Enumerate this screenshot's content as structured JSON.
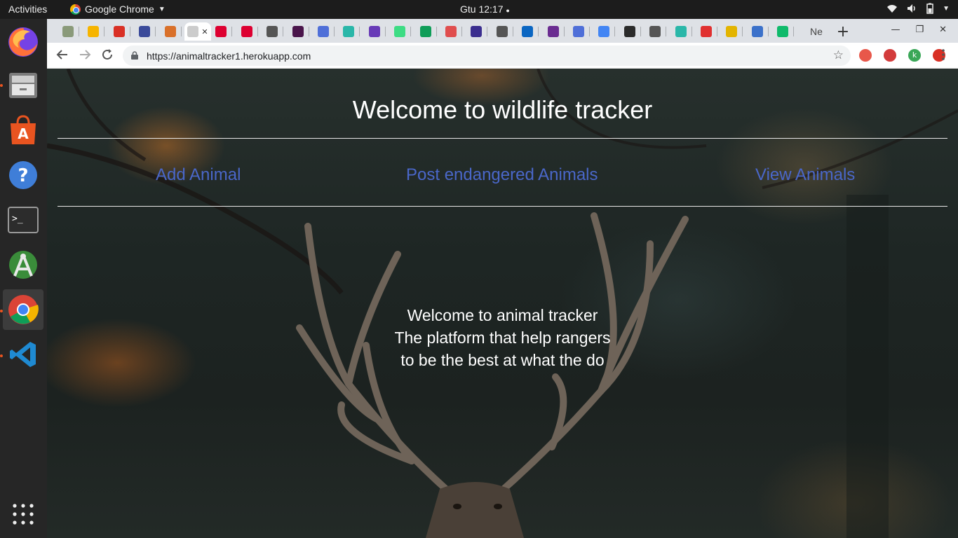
{
  "topbar": {
    "activities": "Activities",
    "app_name": "Google Chrome",
    "clock": "Gtu 12:17"
  },
  "dock": {
    "items": [
      {
        "name": "firefox-icon",
        "running": false
      },
      {
        "name": "files-icon",
        "running": true
      },
      {
        "name": "software-center-icon",
        "running": false
      },
      {
        "name": "help-icon",
        "running": false
      },
      {
        "name": "terminal-icon",
        "running": false
      },
      {
        "name": "android-studio-icon",
        "running": false
      },
      {
        "name": "chrome-icon",
        "running": true,
        "active": true
      },
      {
        "name": "vscode-icon",
        "running": true
      },
      {
        "name": "show-apps-icon",
        "running": false
      }
    ]
  },
  "tabs": [
    {
      "icon": "tree-icon",
      "color": "#8a9a7a"
    },
    {
      "icon": "drive-icon",
      "color": "#f6b400"
    },
    {
      "icon": "gmail-icon",
      "color": "#d93025"
    },
    {
      "icon": "github-icon",
      "color": "#3a4a9a"
    },
    {
      "icon": "book-icon",
      "color": "#d9702a"
    },
    {
      "icon": "animal-tracker-icon",
      "color": "#cccccc",
      "active": true
    },
    {
      "icon": "angular-icon",
      "color": "#dd0031"
    },
    {
      "icon": "angular-icon",
      "color": "#dd0031"
    },
    {
      "icon": "globe-icon",
      "color": "#555555"
    },
    {
      "icon": "slack-icon",
      "color": "#4a154b"
    },
    {
      "icon": "docs-icon",
      "color": "#4f6fd8"
    },
    {
      "icon": "dribbble-icon",
      "color": "#2ab7a9"
    },
    {
      "icon": "forms-icon",
      "color": "#673ab7"
    },
    {
      "icon": "android-icon",
      "color": "#3ddc84"
    },
    {
      "icon": "trello-icon",
      "color": "#0f9d58"
    },
    {
      "icon": "openai-icon",
      "color": "#e04e4e"
    },
    {
      "icon": "eclipse-icon",
      "color": "#3b2e8f"
    },
    {
      "icon": "audio-icon",
      "color": "#555555"
    },
    {
      "icon": "linkedin-icon",
      "color": "#0a66c2"
    },
    {
      "icon": "mail-icon",
      "color": "#6a2c91"
    },
    {
      "icon": "docs-icon",
      "color": "#4f6fd8"
    },
    {
      "icon": "google-icon",
      "color": "#4285f4"
    },
    {
      "icon": "b-icon",
      "color": "#2b2b2b"
    },
    {
      "icon": "globe-icon",
      "color": "#555555"
    },
    {
      "icon": "dribbble-icon",
      "color": "#2ab7a9"
    },
    {
      "icon": "red-app-icon",
      "color": "#e03030"
    },
    {
      "icon": "w-icon",
      "color": "#e3b400"
    },
    {
      "icon": "mdb-icon",
      "color": "#3b71ca"
    },
    {
      "icon": "green-app-icon",
      "color": "#0fba6b"
    }
  ],
  "last_tab_label": "Ne",
  "new_tab_label": "+",
  "address_bar": {
    "url": "https://animaltracker1.herokuapp.com"
  },
  "extensions": [
    {
      "name": "cast-extension-icon",
      "color": "#e8574a"
    },
    {
      "name": "shield-extension-icon",
      "color": "#d33b3b"
    },
    {
      "name": "profile-avatar",
      "color": "#3aa757",
      "label": "k"
    },
    {
      "name": "update-icon",
      "color": "#d93025"
    }
  ],
  "page": {
    "title": "Welcome to wildlife tracker",
    "nav": {
      "add": "Add Animal",
      "post": "Post endangered Animals",
      "view": "View Animals"
    },
    "hero": {
      "line1": "Welcome to animal tracker",
      "line2": "The platform that help rangers",
      "line3": "to be the best at what the do"
    },
    "link_color": "#4a67c9"
  }
}
